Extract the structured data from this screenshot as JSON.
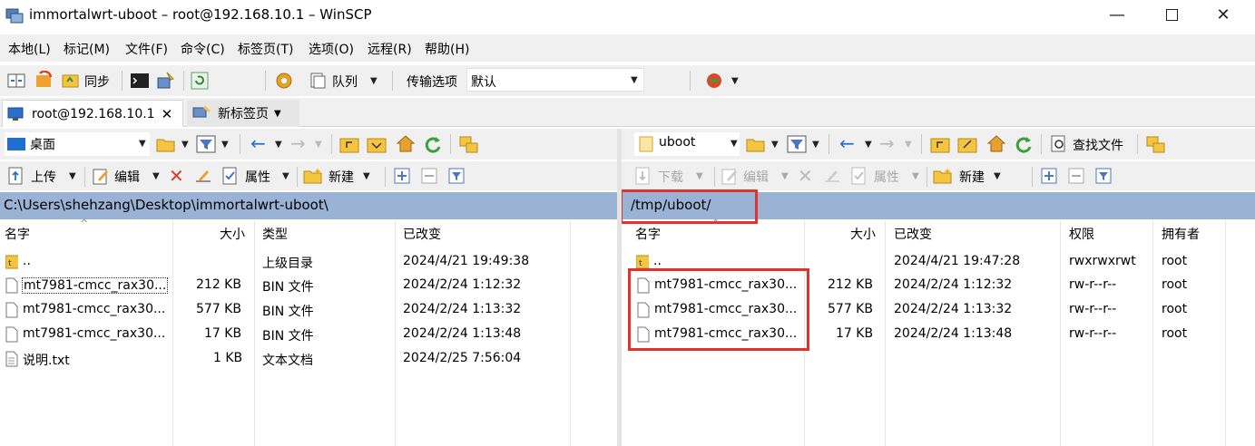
{
  "window": {
    "title": "immortalwrt-uboot – root@192.168.10.1 – WinSCP"
  },
  "menu": [
    "本地(L)",
    "标记(M)",
    "文件(F)",
    "命令(C)",
    "标签页(T)",
    "选项(O)",
    "远程(R)",
    "帮助(H)"
  ],
  "toolbar1": {
    "sync_label": "同步",
    "queue_label": "队列",
    "transfer_label": "传输选项",
    "transfer_value": "默认"
  },
  "tabs": {
    "session_label": "root@192.168.10.1",
    "new_tab_label": "新标签页"
  },
  "left": {
    "location": "桌面",
    "upload_label": "上传",
    "edit_label": "编辑",
    "props_label": "属性",
    "new_label": "新建",
    "path": "C:\\Users\\shehzang\\Desktop\\immortalwrt-uboot\\",
    "columns": {
      "name": "名字",
      "size": "大小",
      "type": "类型",
      "changed": "已改变"
    },
    "rows": [
      {
        "name": "..",
        "size": "",
        "type": "上级目录",
        "changed": "2024/4/21 19:49:38"
      },
      {
        "name": "mt7981-cmcc_rax30...",
        "size": "212 KB",
        "type": "BIN 文件",
        "changed": "2024/2/24 1:12:32"
      },
      {
        "name": "mt7981-cmcc_rax30...",
        "size": "577 KB",
        "type": "BIN 文件",
        "changed": "2024/2/24 1:13:32"
      },
      {
        "name": "mt7981-cmcc_rax30...",
        "size": "17 KB",
        "type": "BIN 文件",
        "changed": "2024/2/24 1:13:48"
      },
      {
        "name": "说明.txt",
        "size": "1 KB",
        "type": "文本文档",
        "changed": "2024/2/25 7:56:04"
      }
    ]
  },
  "right": {
    "location": "uboot",
    "find_label": "查找文件",
    "download_label": "下载",
    "edit_label": "编辑",
    "props_label": "属性",
    "new_label": "新建",
    "path": "/tmp/uboot/",
    "columns": {
      "name": "名字",
      "size": "大小",
      "changed": "已改变",
      "rights": "权限",
      "owner": "拥有者"
    },
    "rows": [
      {
        "name": "..",
        "size": "",
        "changed": "2024/4/21 19:47:28",
        "rights": "rwxrwxrwt",
        "owner": "root"
      },
      {
        "name": "mt7981-cmcc_rax30...",
        "size": "212 KB",
        "changed": "2024/2/24 1:12:32",
        "rights": "rw-r--r--",
        "owner": "root"
      },
      {
        "name": "mt7981-cmcc_rax30...",
        "size": "577 KB",
        "changed": "2024/2/24 1:13:32",
        "rights": "rw-r--r--",
        "owner": "root"
      },
      {
        "name": "mt7981-cmcc_rax30...",
        "size": "17 KB",
        "changed": "2024/2/24 1:13:48",
        "rights": "rw-r--r--",
        "owner": "root"
      }
    ]
  },
  "colors": {
    "path_bar": "#9ab3d4",
    "highlight": "#e0322e",
    "folder": "#f5c542"
  },
  "icons": [
    "winscp-app-icon",
    "minimize-icon",
    "maximize-icon",
    "close-icon",
    "folder-icon",
    "file-icon",
    "parent-folder-icon",
    "refresh-icon",
    "home-icon",
    "filter-icon",
    "gear-icon",
    "back-arrow-icon",
    "forward-arrow-icon"
  ]
}
